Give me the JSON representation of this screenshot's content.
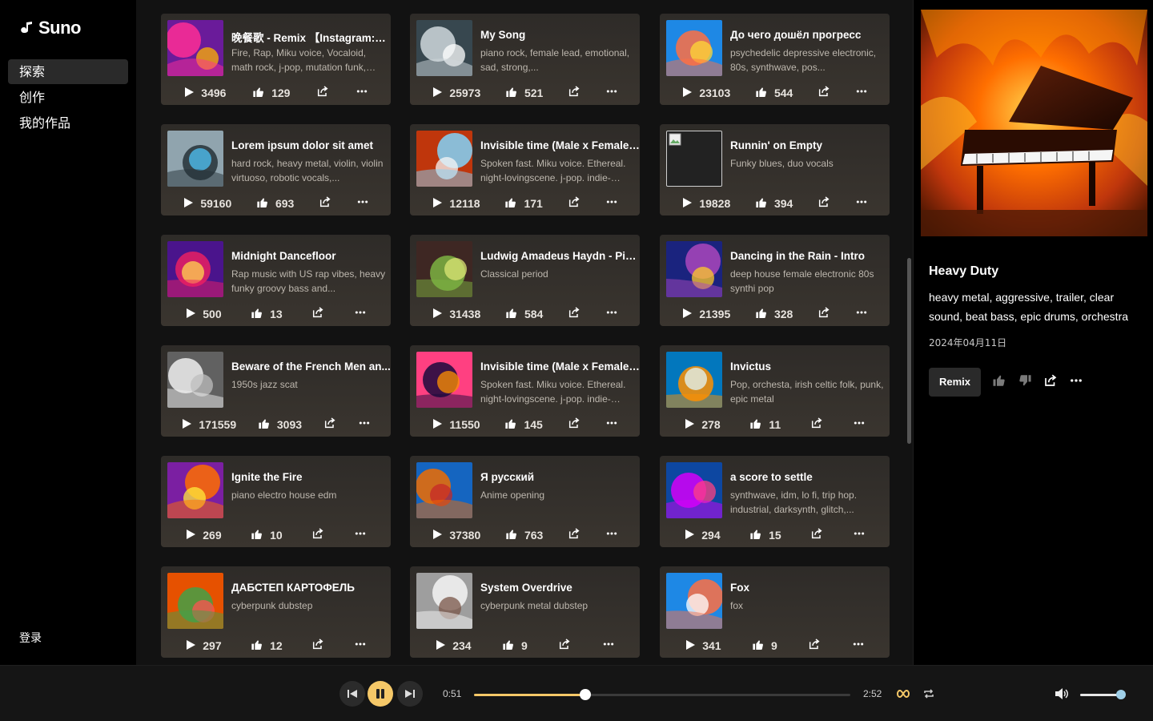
{
  "app": {
    "name": "Suno"
  },
  "sidebar": {
    "items": [
      {
        "label": "探索",
        "active": true
      },
      {
        "label": "创作",
        "active": false
      },
      {
        "label": "我的作品",
        "active": false
      }
    ],
    "login": "登录"
  },
  "songs": [
    {
      "title": "晚餐歌 - Remix 【Instagram:A...",
      "desc": "Fire, Rap, Miku voice, Vocaloid, math rock, j-pop, mutation funk, bounce...",
      "plays": "3496",
      "likes": "129",
      "art": [
        "#ff2d95",
        "#6a1b9a",
        "#ffb300"
      ]
    },
    {
      "title": "My Song",
      "desc": "piano rock, female lead, emotional, sad, strong,...",
      "plays": "25973",
      "likes": "521",
      "art": [
        "#cfd8dc",
        "#37474f",
        "#ffffff"
      ]
    },
    {
      "title": "До чего дошёл прогресс",
      "desc": "psychedelic depressive electronic, 80s, synthwave, pos...",
      "plays": "23103",
      "likes": "544",
      "art": [
        "#ff7043",
        "#1e88e5",
        "#fdd835"
      ]
    },
    {
      "title": "Lorem ipsum dolor sit amet",
      "desc": "hard rock, heavy metal, violin, violin virtuoso, robotic vocals,...",
      "plays": "59160",
      "likes": "693",
      "art": [
        "#263238",
        "#90a4ae",
        "#4fc3f7"
      ]
    },
    {
      "title": "Invisible time (Male x Female ...",
      "desc": "Spoken fast. Miku voice. Ethereal. night-lovingscene. j-pop. indie-rock....",
      "plays": "12118",
      "likes": "171",
      "art": [
        "#81d4fa",
        "#bf360c",
        "#f5f5f5"
      ]
    },
    {
      "title": "Runnin' on Empty",
      "desc": "Funky blues, duo vocals",
      "plays": "19828",
      "likes": "394",
      "art": [
        "#111111",
        "#111111",
        "#111111"
      ]
    },
    {
      "title": "Midnight Dancefloor",
      "desc": "Rap music with US rap vibes, heavy funky groovy bass and...",
      "plays": "500",
      "likes": "13",
      "art": [
        "#e91e63",
        "#4a148c",
        "#ffd54f"
      ]
    },
    {
      "title": "Ludwig Amadeus Haydn - Pia...",
      "desc": "Classical period",
      "plays": "31438",
      "likes": "584",
      "art": [
        "#7cb342",
        "#3e2723",
        "#dce775"
      ]
    },
    {
      "title": "Dancing in the Rain - Intro",
      "desc": "deep house female electronic 80s synthi pop",
      "plays": "21395",
      "likes": "328",
      "art": [
        "#ab47bc",
        "#1a237e",
        "#ffca28"
      ]
    },
    {
      "title": "Beware of the French Men an...",
      "desc": "1950s jazz scat",
      "plays": "171559",
      "likes": "3093",
      "art": [
        "#eeeeee",
        "#616161",
        "#bdbdbd"
      ]
    },
    {
      "title": "Invisible time (Male x Female ...",
      "desc": "Spoken fast. Miku voice. Ethereal. night-lovingscene. j-pop. indie-rock....",
      "plays": "11550",
      "likes": "145",
      "art": [
        "#1a0a3d",
        "#ff4081",
        "#ff9100"
      ]
    },
    {
      "title": "Invictus",
      "desc": "Pop, orchesta, irish celtic folk, punk, epic metal",
      "plays": "278",
      "likes": "11",
      "art": [
        "#ff8f00",
        "#0277bd",
        "#e0f7fa"
      ]
    },
    {
      "title": "Ignite the Fire",
      "desc": "piano electro house edm",
      "plays": "269",
      "likes": "10",
      "art": [
        "#ff6d00",
        "#7b1fa2",
        "#ffeb3b"
      ]
    },
    {
      "title": "Я русский",
      "desc": "Anime opening",
      "plays": "37380",
      "likes": "763",
      "art": [
        "#ef6c00",
        "#1565c0",
        "#c62828"
      ]
    },
    {
      "title": "a score to settle",
      "desc": "synthwave, idm, lo fi, trip hop. industrial, darksynth, glitch,...",
      "plays": "294",
      "likes": "15",
      "art": [
        "#d500f9",
        "#0d47a1",
        "#ff4081"
      ]
    },
    {
      "title": "ДАБСТЕП КАРТОФЕЛЬ",
      "desc": "cyberpunk dubstep",
      "plays": "297",
      "likes": "12",
      "art": [
        "#43a047",
        "#e65100",
        "#ff5252"
      ]
    },
    {
      "title": "System Overdrive",
      "desc": "cyberpunk metal dubstep",
      "plays": "234",
      "likes": "9",
      "art": [
        "#f5f5f5",
        "#9e9e9e",
        "#795548"
      ]
    },
    {
      "title": "Fox",
      "desc": "fox",
      "plays": "341",
      "likes": "9",
      "art": [
        "#ff7043",
        "#1e88e5",
        "#ffffff"
      ]
    }
  ],
  "now_playing": {
    "title": "Heavy Duty",
    "tags": "heavy metal, aggressive, trailer, clear sound, beat bass, epic drums, orchestra",
    "date": "2024年04月11日",
    "remix_label": "Remix"
  },
  "player": {
    "current_time": "0:51",
    "duration": "2:52",
    "progress": 0.2965,
    "volume": 0.98,
    "accent": "#f5c868"
  }
}
